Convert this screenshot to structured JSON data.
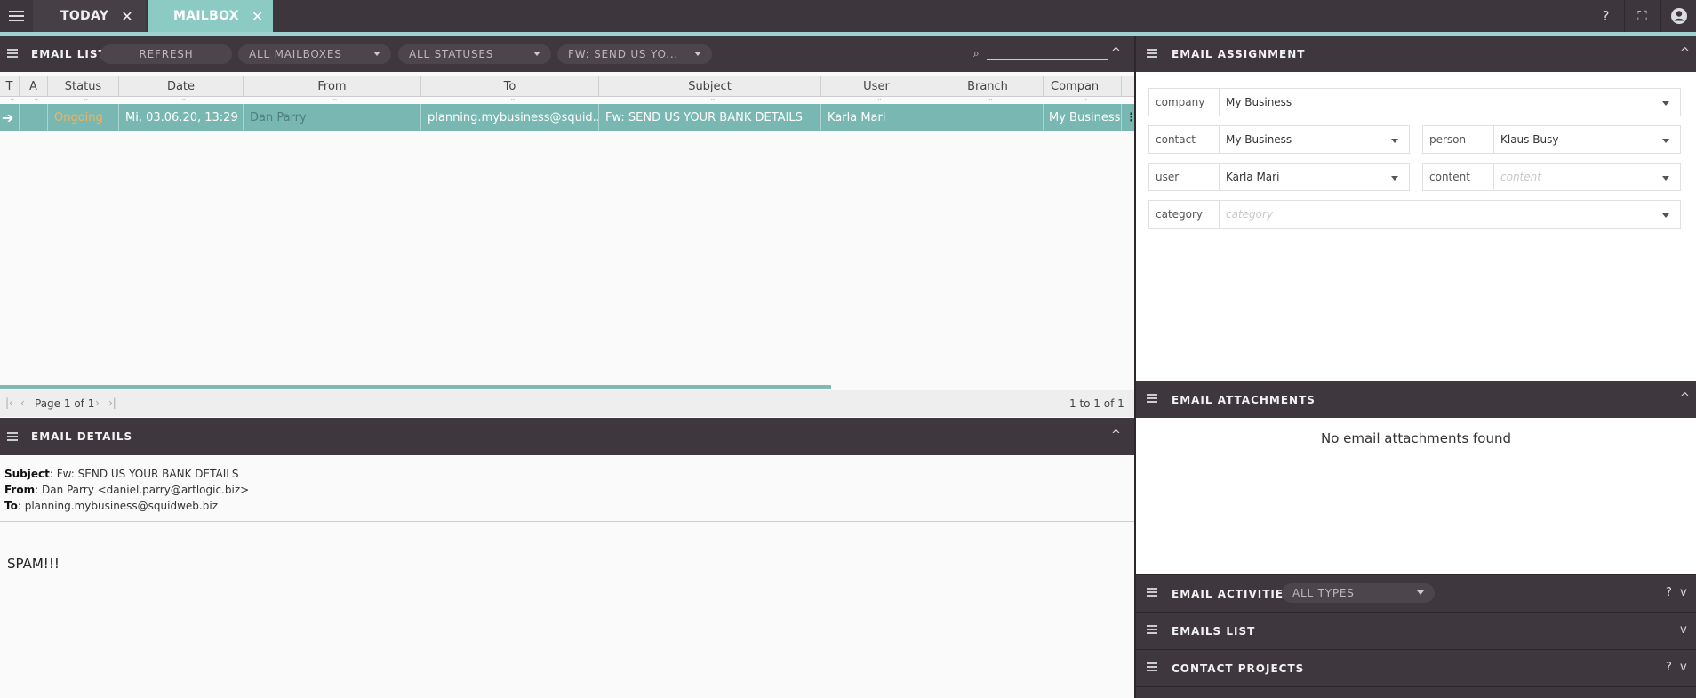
{
  "topbar": {
    "tabs": [
      {
        "label": "TODAY",
        "close": "✕"
      },
      {
        "label": "MAILBOX",
        "close": "✕"
      }
    ],
    "icons": [
      "help-icon",
      "fullscreen-icon",
      "account-icon"
    ],
    "help_glyph": "?",
    "fullscreen_glyph": "⛶",
    "account_glyph": "👤"
  },
  "email_list": {
    "title": "EMAIL LIST",
    "refresh_label": "REFRESH",
    "filters": [
      {
        "label": "ALL MAILBOXES"
      },
      {
        "label": "ALL STATUSES"
      },
      {
        "label": "FW: SEND US YO..."
      }
    ],
    "columns": [
      "T",
      "A",
      "Status",
      "Date",
      "From",
      "To",
      "Subject",
      "User",
      "Branch",
      "Compan"
    ],
    "rows": [
      {
        "t": "➔",
        "a": "",
        "status": "Ongoing",
        "date": "Mi, 03.06.20, 13:29",
        "from": "Dan Parry",
        "to": "planning.mybusiness@squid...",
        "subject": "Fw: SEND US YOUR BANK DETAILS",
        "user": "Karla Mari",
        "branch": "",
        "company": "My Business"
      }
    ],
    "pager": {
      "page_text": "Page 1 of 1",
      "range_text": "1 to 1 of 1"
    }
  },
  "email_details": {
    "title": "EMAIL DETAILS",
    "subject_label": "Subject",
    "subject": "Fw: SEND US YOUR BANK DETAILS",
    "from_label": "From",
    "from": "Dan Parry <daniel.parry@artlogic.biz>",
    "to_label": "To",
    "to": "planning.mybusiness@squidweb.biz",
    "body": "SPAM!!!"
  },
  "email_assignment": {
    "title": "EMAIL ASSIGNMENT",
    "fields": {
      "company": {
        "label": "company",
        "value": "My Business"
      },
      "contact": {
        "label": "contact",
        "value": "My Business"
      },
      "person": {
        "label": "person",
        "value": "Klaus Busy"
      },
      "user": {
        "label": "user",
        "value": "Karla Mari"
      },
      "content": {
        "label": "content",
        "placeholder": "content"
      },
      "category": {
        "label": "category",
        "placeholder": "category"
      }
    }
  },
  "email_attachments": {
    "title": "EMAIL ATTACHMENTS",
    "empty_text": "No email attachments found"
  },
  "email_activities": {
    "title": "EMAIL ACTIVITIES",
    "filter": "ALL TYPES"
  },
  "emails_list": {
    "title": "EMAILS LIST"
  },
  "contact_projects": {
    "title": "CONTACT PROJECTS"
  },
  "colors": {
    "accent": "#8ccac4",
    "header": "#3e373d",
    "status_ongoing": "#f0b25e"
  }
}
